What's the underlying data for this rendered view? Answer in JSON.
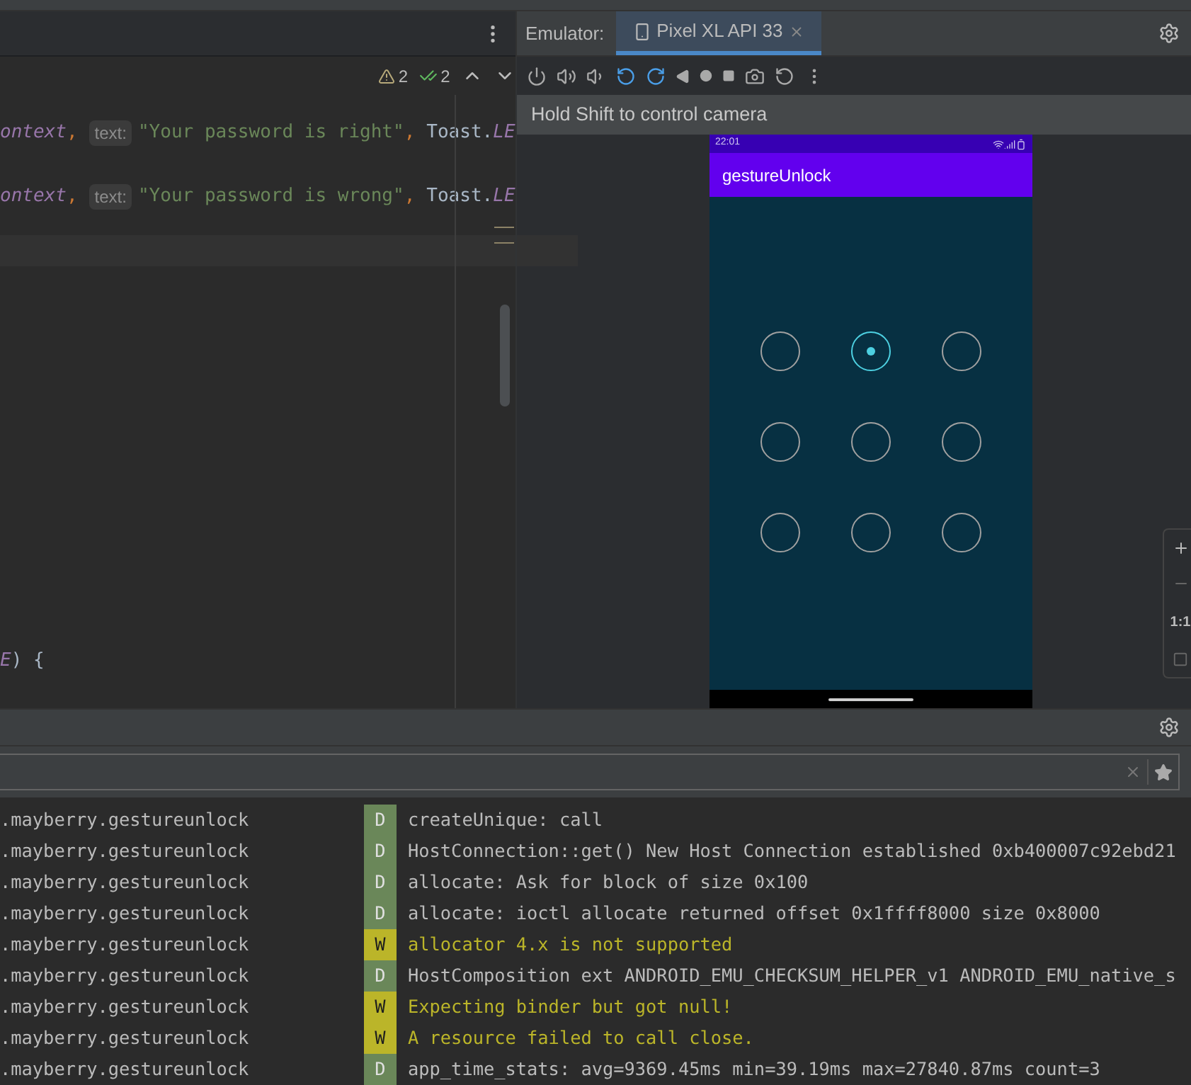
{
  "editor": {
    "problems": [
      {
        "kind": "warning",
        "count": "2"
      },
      {
        "kind": "check",
        "count": "2"
      }
    ],
    "code_lines": [
      {
        "tokens": [
          {
            "kind": "ident",
            "text": "ontext"
          },
          {
            "kind": "punct",
            "text": ","
          },
          {
            "kind": "hint",
            "text": "text:"
          },
          {
            "kind": "string",
            "text": "\"Your password is right\""
          },
          {
            "kind": "punct",
            "text": ","
          },
          {
            "kind": "plain",
            "text": "Toast."
          },
          {
            "kind": "ident",
            "text": "LE"
          }
        ]
      },
      {
        "tokens": [
          {
            "kind": "ident",
            "text": "ontext"
          },
          {
            "kind": "punct",
            "text": ","
          },
          {
            "kind": "hint",
            "text": "text:"
          },
          {
            "kind": "string",
            "text": "\"Your password is wrong\""
          },
          {
            "kind": "punct",
            "text": ","
          },
          {
            "kind": "plain",
            "text": "Toast."
          },
          {
            "kind": "ident",
            "text": "LE"
          }
        ]
      },
      {
        "tokens": [
          {
            "kind": "ident",
            "text": "E"
          },
          {
            "kind": "plain",
            "text": ") {"
          }
        ]
      }
    ]
  },
  "emulator": {
    "label": "Emulator:",
    "tab": {
      "title": "Pixel XL API 33",
      "selected": true
    },
    "hint": "Hold Shift to control camera",
    "device": {
      "time": "22:01",
      "app_title": "gestureUnlock",
      "dots": [
        {
          "selected": false
        },
        {
          "selected": true
        },
        {
          "selected": false
        },
        {
          "selected": false
        },
        {
          "selected": false
        },
        {
          "selected": false
        },
        {
          "selected": false
        },
        {
          "selected": false
        },
        {
          "selected": false
        }
      ]
    },
    "zoom_label": "1:1"
  },
  "logcat": {
    "rows": [
      {
        "package": ".mayberry.gestureunlock",
        "level": "D",
        "message": "createUnique: call"
      },
      {
        "package": ".mayberry.gestureunlock",
        "level": "D",
        "message": "HostConnection::get() New Host Connection established 0xb400007c92ebd21"
      },
      {
        "package": ".mayberry.gestureunlock",
        "level": "D",
        "message": "allocate: Ask for block of size 0x100"
      },
      {
        "package": ".mayberry.gestureunlock",
        "level": "D",
        "message": "allocate: ioctl allocate returned offset 0x1ffff8000 size 0x8000"
      },
      {
        "package": ".mayberry.gestureunlock",
        "level": "W",
        "message": "allocator 4.x is not supported"
      },
      {
        "package": ".mayberry.gestureunlock",
        "level": "D",
        "message": "HostComposition ext ANDROID_EMU_CHECKSUM_HELPER_v1 ANDROID_EMU_native_s"
      },
      {
        "package": ".mayberry.gestureunlock",
        "level": "W",
        "message": "Expecting binder but got null!"
      },
      {
        "package": ".mayberry.gestureunlock",
        "level": "W",
        "message": "A resource failed to call close."
      },
      {
        "package": ".mayberry.gestureunlock",
        "level": "D",
        "message": "app_time_stats: avg=9369.45ms min=39.19ms max=27840.87ms count=3"
      }
    ]
  }
}
